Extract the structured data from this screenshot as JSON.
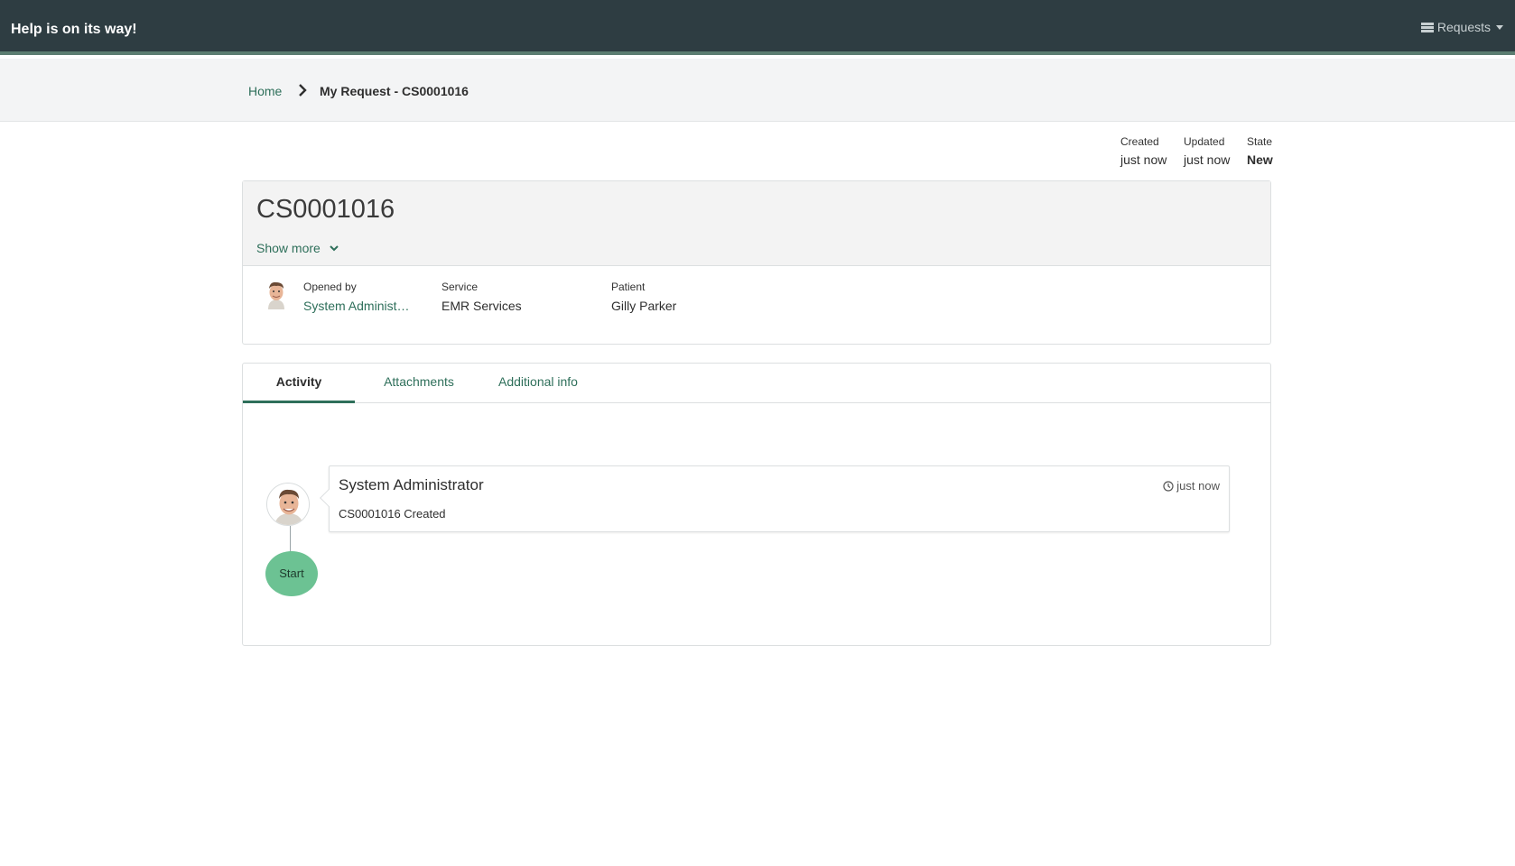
{
  "header": {
    "brand": "Help is on its way!",
    "menu_label": "Requests",
    "menu_icon": "list-icon"
  },
  "breadcrumb": {
    "home": "Home",
    "current": "My Request - CS0001016"
  },
  "meta": {
    "created_label": "Created",
    "created_value": "just now",
    "updated_label": "Updated",
    "updated_value": "just now",
    "state_label": "State",
    "state_value": "New"
  },
  "summary": {
    "number": "CS0001016",
    "show_more": "Show more",
    "fields": {
      "opened_by_label": "Opened by",
      "opened_by_value": "System Administ…",
      "service_label": "Service",
      "service_value": "EMR Services",
      "patient_label": "Patient",
      "patient_value": "Gilly Parker"
    }
  },
  "tabs": [
    {
      "label": "Activity",
      "active": true
    },
    {
      "label": "Attachments",
      "active": false
    },
    {
      "label": "Additional info",
      "active": false
    }
  ],
  "activity": {
    "entries": [
      {
        "author": "System Administrator",
        "time": "just now",
        "text": "CS0001016 Created"
      }
    ],
    "start_label": "Start"
  },
  "colors": {
    "header_bg": "#2e3d42",
    "accent": "#2e6f5a",
    "start_node": "#6cc293"
  }
}
